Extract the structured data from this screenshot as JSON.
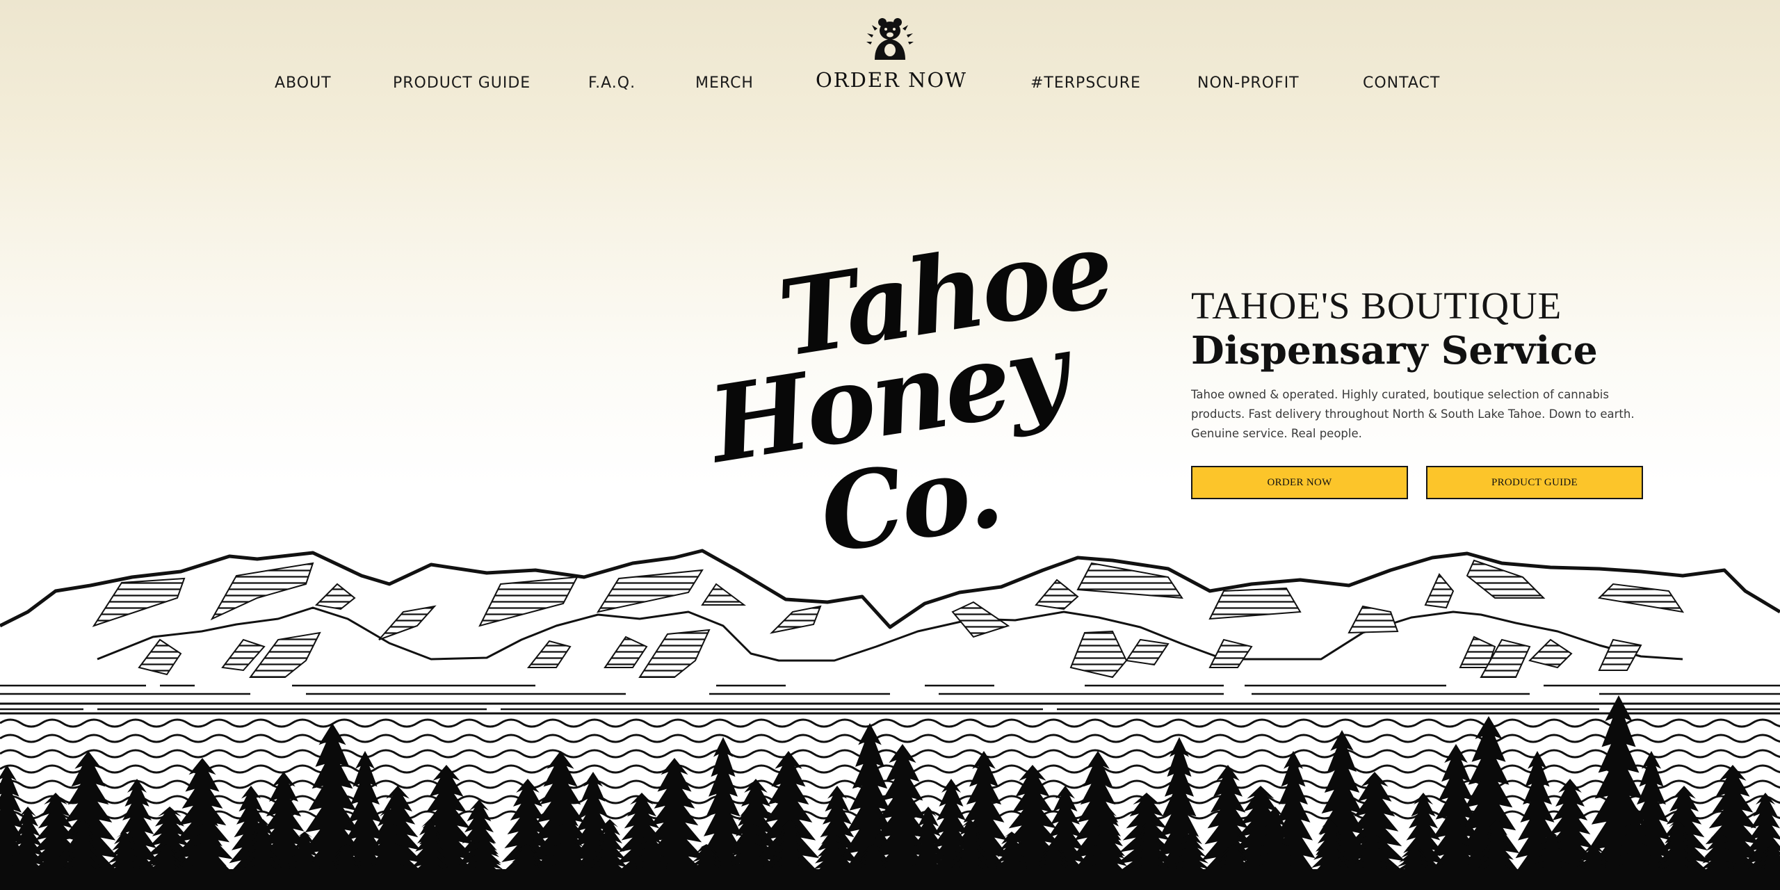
{
  "nav": {
    "logo_icon": "bear-emblem-icon",
    "items": [
      {
        "label": "ABOUT"
      },
      {
        "label": "PRODUCT GUIDE"
      },
      {
        "label": "F.A.Q."
      },
      {
        "label": "MERCH"
      },
      {
        "label": "ORDER NOW"
      },
      {
        "label": "#TERPSCURE"
      },
      {
        "label": "NON-PROFIT"
      },
      {
        "label": "CONTACT"
      }
    ]
  },
  "brand": {
    "line1": "Tahoe",
    "line2": "Honey",
    "line3": "Co."
  },
  "hero": {
    "subtitle": "TAHOE'S BOUTIQUE",
    "title": "Dispensary Service",
    "description": "Tahoe owned & operated. Highly curated, boutique selection of cannabis products. Fast delivery throughout North & South Lake Tahoe. Down to earth. Genuine service. Real people.",
    "buttons": {
      "order": "ORDER NOW",
      "guide": "PRODUCT GUIDE"
    },
    "button_color": "#fcc52a"
  },
  "illustration": {
    "icon": "mountains-lake-forest-illustration"
  }
}
